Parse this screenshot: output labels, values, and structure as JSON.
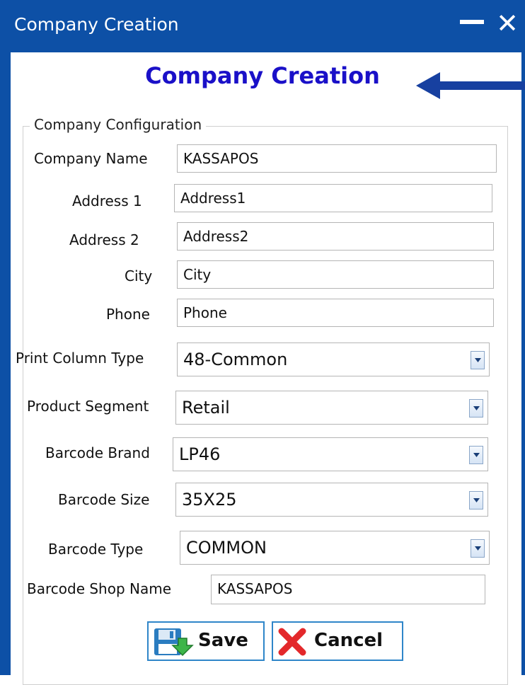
{
  "window": {
    "title": "Company Creation"
  },
  "form": {
    "heading": "Company Creation",
    "group_title": "Company Configuration",
    "fields": {
      "company_name": {
        "label": "Company Name",
        "value": "KASSAPOS"
      },
      "address1": {
        "label": "Address 1",
        "value": "Address1"
      },
      "address2": {
        "label": "Address 2",
        "value": "Address2"
      },
      "city": {
        "label": "City",
        "value": "City"
      },
      "phone": {
        "label": "Phone",
        "value": "Phone"
      },
      "print_column_type": {
        "label": "Print Column Type",
        "value": "48-Common"
      },
      "product_segment": {
        "label": "Product Segment",
        "value": "Retail"
      },
      "barcode_brand": {
        "label": "Barcode Brand",
        "value": "LP46"
      },
      "barcode_size": {
        "label": "Barcode Size",
        "value": "35X25"
      },
      "barcode_type": {
        "label": "Barcode Type",
        "value": "COMMON"
      },
      "barcode_shop_name": {
        "label": "Barcode Shop Name",
        "value": "KASSAPOS"
      }
    },
    "buttons": {
      "save": "Save",
      "cancel": "Cancel"
    }
  },
  "colors": {
    "titlebar": "#0d50a6",
    "heading": "#1a10c8",
    "arrow": "#1740a0",
    "button_border": "#2f86c9"
  },
  "icons": {
    "save": "floppy-disk-icon",
    "cancel": "red-x-icon",
    "dropdown": "chevron-down-icon",
    "arrow": "arrow-left-icon"
  }
}
